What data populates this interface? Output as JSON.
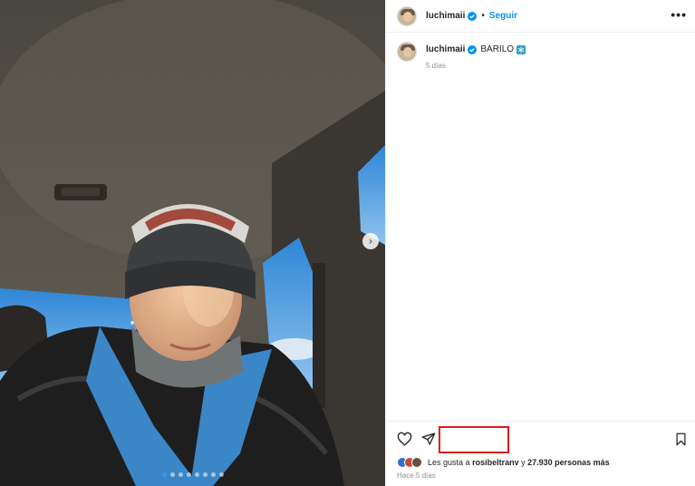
{
  "post": {
    "username": "luchimaii",
    "separator": "•",
    "follow_label": "Seguir",
    "more_label": "•••",
    "caption": {
      "username": "luchimaii",
      "text": "BARILO",
      "time": "5 días"
    },
    "carousel": {
      "next_label": "›",
      "slide_count": 8,
      "active_index": 0
    },
    "likes": {
      "prefix": "Les gusta a",
      "user": "rosibeltranv",
      "middle": "y",
      "others": "27.930 personas más"
    },
    "ago": "Hace 5 días"
  },
  "colors": {
    "link": "#0095f6",
    "verified": "#0095f6",
    "highlight": "#e0191b",
    "muted": "#8e8e8e"
  },
  "icons": [
    "verified-badge-icon",
    "snowflake-icon",
    "heart-icon",
    "share-icon",
    "bookmark-icon",
    "chevron-right-icon"
  ]
}
